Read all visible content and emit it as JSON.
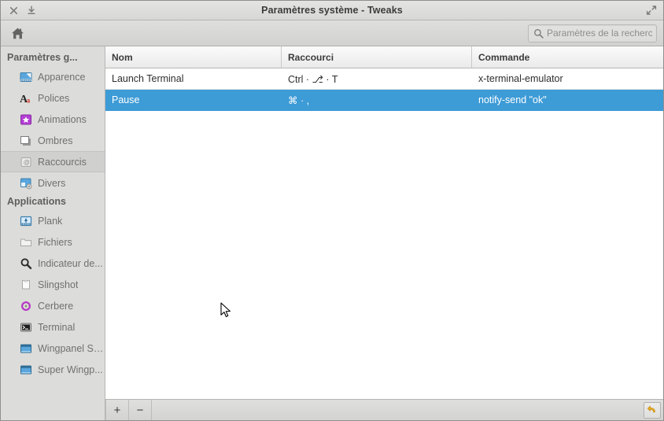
{
  "window": {
    "title": "Paramètres système - Tweaks",
    "close_label": "×",
    "minimize_label": "⤓",
    "maximize_label": "maximize"
  },
  "toolbar": {
    "home_icon": "home-icon",
    "search_icon": "search-icon",
    "search_placeholder": "Paramètres de la recherche"
  },
  "sidebar": {
    "sections": [
      {
        "title": "Paramètres g...",
        "items": [
          {
            "label": "Apparence",
            "icon": "appearance-icon",
            "selected": false
          },
          {
            "label": "Polices",
            "icon": "fonts-icon",
            "selected": false
          },
          {
            "label": "Animations",
            "icon": "animations-icon",
            "selected": false
          },
          {
            "label": "Ombres",
            "icon": "shadows-icon",
            "selected": false
          },
          {
            "label": "Raccourcis",
            "icon": "shortcuts-icon",
            "selected": true
          },
          {
            "label": "Divers",
            "icon": "misc-icon",
            "selected": false
          }
        ]
      },
      {
        "title": "Applications",
        "items": [
          {
            "label": "Plank",
            "icon": "plank-icon",
            "selected": false
          },
          {
            "label": "Fichiers",
            "icon": "files-icon",
            "selected": false
          },
          {
            "label": "Indicateur de...",
            "icon": "indicator-icon",
            "selected": false
          },
          {
            "label": "Slingshot",
            "icon": "slingshot-icon",
            "selected": false
          },
          {
            "label": "Cerbere",
            "icon": "cerbere-icon",
            "selected": false
          },
          {
            "label": "Terminal",
            "icon": "terminal-icon",
            "selected": false
          },
          {
            "label": "Wingpanel Slim",
            "icon": "wingpanel-slim-icon",
            "selected": false
          },
          {
            "label": "Super Wingp...",
            "icon": "super-wingpanel-icon",
            "selected": false
          }
        ]
      }
    ]
  },
  "table": {
    "columns": [
      "Nom",
      "Raccourci",
      "Commande"
    ],
    "rows": [
      {
        "name": "Launch Terminal",
        "shortcut": "Ctrl · ⎇ · T",
        "command": "x-terminal-emulator",
        "selected": false
      },
      {
        "name": "Pause",
        "shortcut": "⌘ · ,",
        "command": "notify-send \"ok\"",
        "selected": true
      }
    ]
  },
  "actionbar": {
    "add_label": "+",
    "remove_label": "−",
    "restore_icon": "restore-defaults-icon"
  },
  "colors": {
    "selection_blue": "#3d9bd6",
    "sidebar_bg": "#dcdcda",
    "chrome_bg": "#d7d7d5",
    "content_bg": "#ffffff"
  }
}
